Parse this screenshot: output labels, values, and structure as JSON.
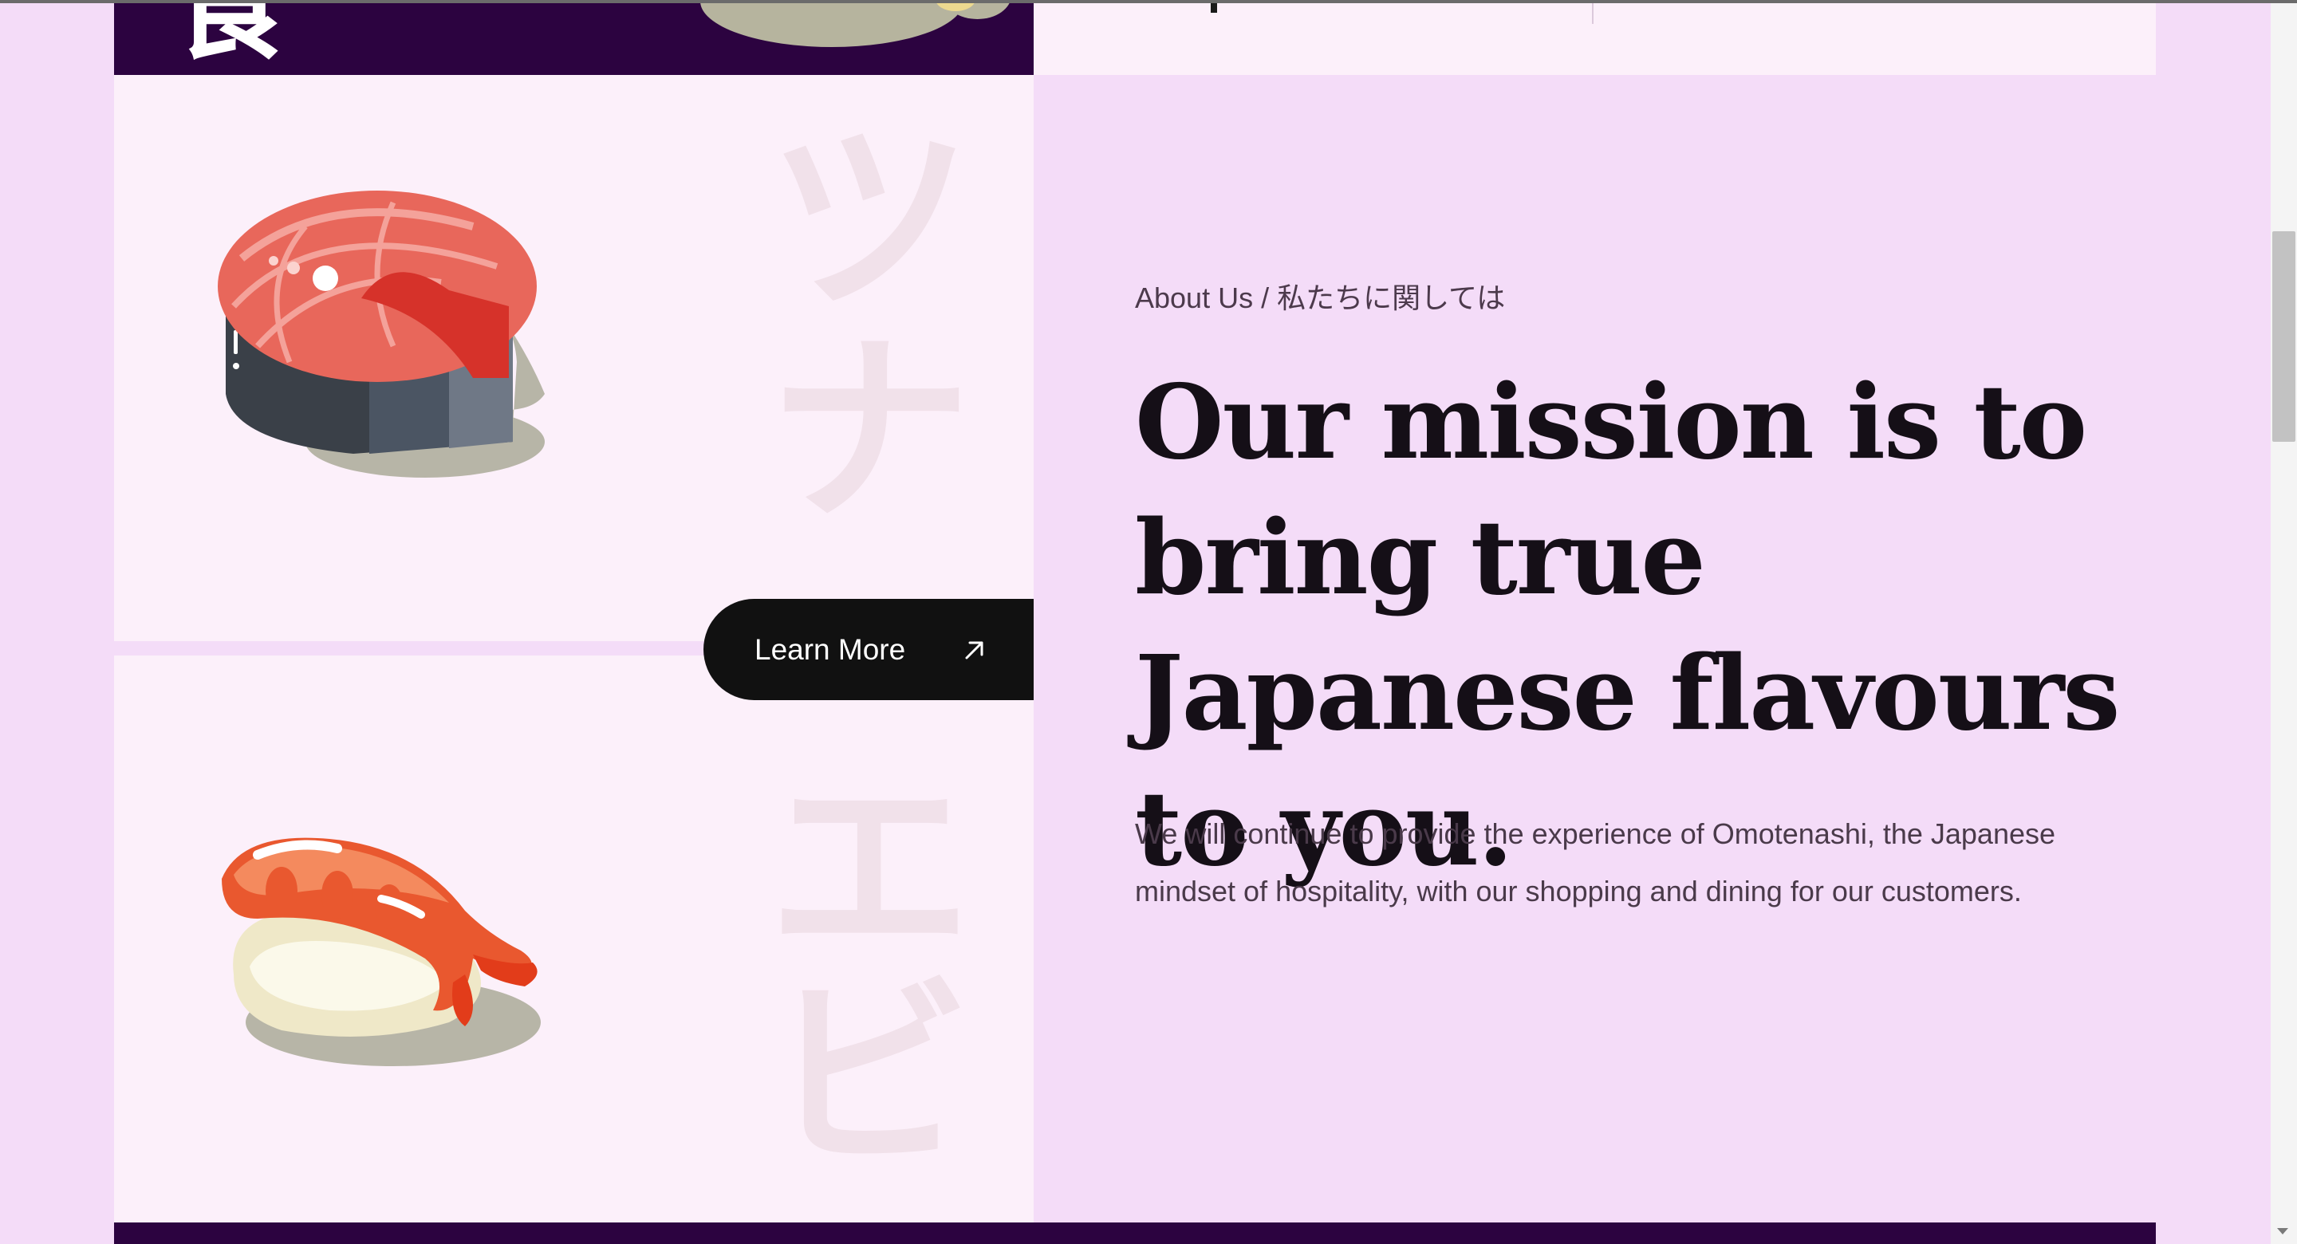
{
  "previous_section": {
    "logo_glyph": "食"
  },
  "food_panels": [
    {
      "item": "tuna",
      "kanji": [
        "ツ",
        "ナ"
      ]
    },
    {
      "item": "shrimp",
      "kanji": [
        "エ",
        "ビ"
      ]
    }
  ],
  "cta": {
    "label": "Learn More",
    "icon": "arrow-up-right-icon"
  },
  "about": {
    "eyebrow": "About Us / 私たちに関しては",
    "heading": "Our mission is to bring true Japanese flavours to you.",
    "body": "We will continue to provide the experience of Omotenashi, the Japanese mindset of hospitality, with our shopping and dining for our customers."
  },
  "colors": {
    "page_background": "#f4dcf8",
    "panel_background": "#fcf0fa",
    "dark_band": "#2c0340",
    "button": "#111111",
    "heading_text": "#150f17"
  },
  "scrollbar": {
    "icon_down": "chevron-down-icon"
  }
}
